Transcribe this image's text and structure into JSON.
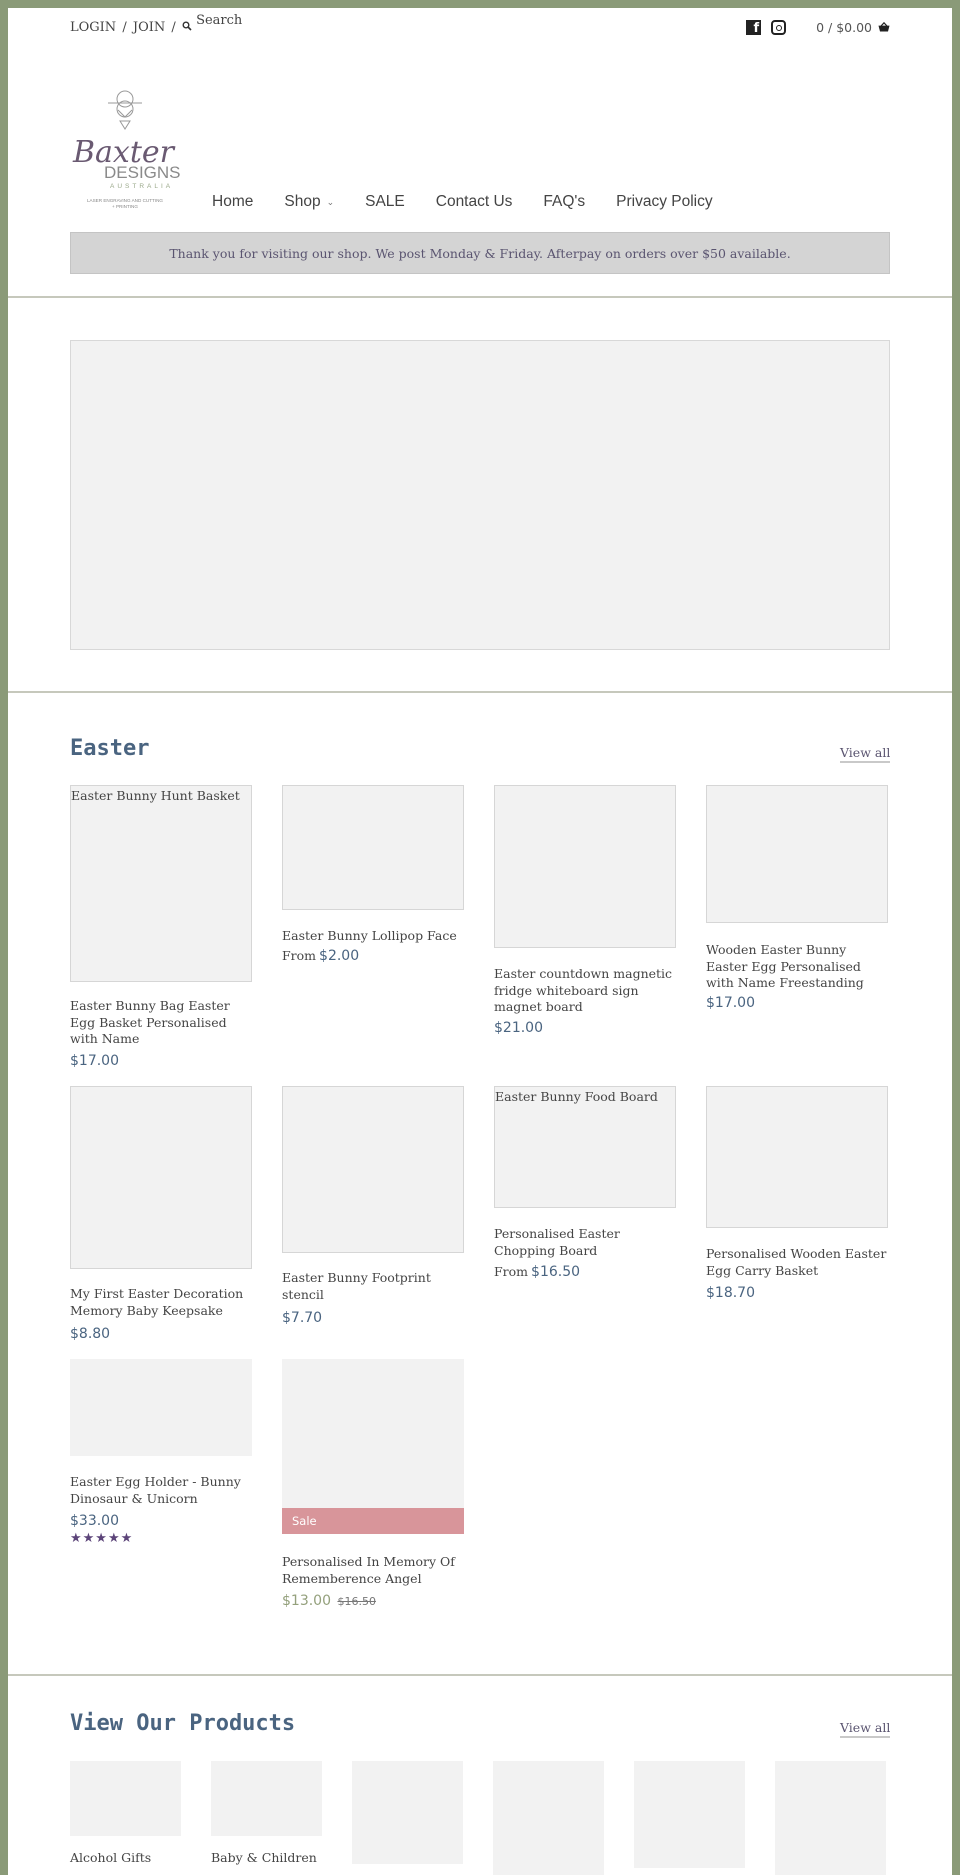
{
  "header": {
    "login_label": "LOGIN",
    "join_label": "JOIN",
    "separator": "/",
    "search_label": "Search",
    "cart_summary": "0 / $0.00",
    "icons": {
      "search": "search-icon",
      "facebook": "facebook-icon",
      "instagram": "instagram-icon",
      "cart": "basket-icon"
    }
  },
  "logo": {
    "script_text": "Baxter",
    "designs_text": "DESIGNS",
    "australia_text": "AUSTRALIA",
    "tagline_line1": "LASER ENGRAVING AND CUTTING",
    "tagline_line2": "+ PRINTING"
  },
  "nav": {
    "items": [
      {
        "label": "Home"
      },
      {
        "label": "Shop",
        "has_dropdown": true
      },
      {
        "label": "SALE"
      },
      {
        "label": "Contact Us"
      },
      {
        "label": "FAQ's"
      },
      {
        "label": "Privacy Policy"
      }
    ]
  },
  "announcement": "Thank you for visiting our shop. We post Monday & Friday. Afterpay on orders over $50 available.",
  "easter": {
    "title": "Easter",
    "view_all": "View all",
    "products": [
      {
        "alt": "Easter Bunny Hunt Basket",
        "title": "Easter Bunny Bag Easter Egg Basket Personalised with Name",
        "price": "$17.00"
      },
      {
        "alt": "",
        "title": "Easter Bunny Lollipop Face",
        "from": "From",
        "price": "$2.00"
      },
      {
        "alt": "",
        "title": "Easter countdown magnetic fridge whiteboard sign magnet board",
        "price": "$21.00"
      },
      {
        "alt": "",
        "title": "Wooden Easter Bunny Easter Egg Personalised with Name Freestanding",
        "price": "$17.00"
      },
      {
        "alt": "",
        "title": "My First Easter Decoration Memory Baby Keepsake",
        "price": "$8.80"
      },
      {
        "alt": "",
        "title": "Easter Bunny Footprint stencil",
        "price": "$7.70"
      },
      {
        "alt": "Easter Bunny Food Board",
        "title": "Personalised Easter Chopping Board",
        "from": "From",
        "price": "$16.50"
      },
      {
        "alt": "",
        "title": "Personalised Wooden Easter Egg Carry Basket",
        "price": "$18.70"
      },
      {
        "alt": "",
        "title": "Easter Egg Holder - Bunny Dinosaur & Unicorn",
        "price": "$33.00",
        "rating": 5,
        "rating_max": 5,
        "stars": "★★★★★"
      },
      {
        "alt": "",
        "title": "Personalised In Memory Of Rememberence Angel",
        "badge": "Sale",
        "price": "$13.00",
        "compare_price": "$16.50"
      }
    ]
  },
  "view_products": {
    "title": "View Our Products",
    "view_all": "View all",
    "categories": [
      {
        "title": "Alcohol Gifts"
      },
      {
        "title": "Baby & Children"
      },
      {
        "title": ""
      },
      {
        "title": ""
      },
      {
        "title": ""
      },
      {
        "title": ""
      }
    ]
  },
  "colors": {
    "frame": "#8a9a78",
    "heading_blue": "#4a6480",
    "sale_badge": "#d8959a",
    "sale_price": "#94a07c",
    "star": "#5c4479",
    "announcement_bg": "#d4d4d4"
  }
}
